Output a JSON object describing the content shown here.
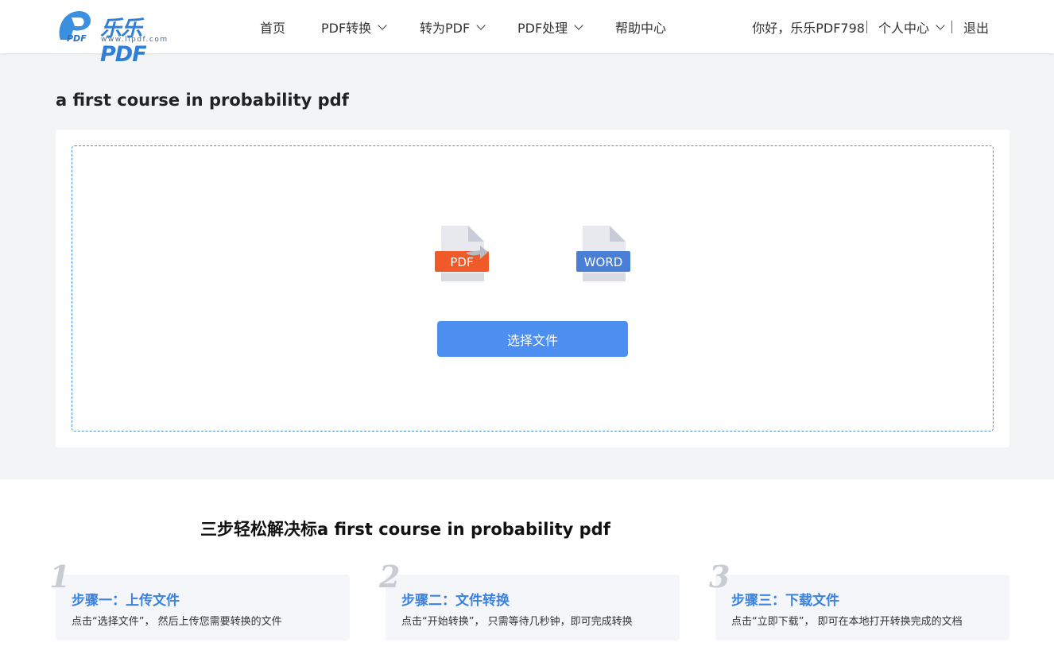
{
  "header": {
    "logo_text": "乐乐PDF",
    "logo_sub": "www.llpdf.com",
    "nav": [
      {
        "label": "首页",
        "has_dropdown": false
      },
      {
        "label": "PDF转换",
        "has_dropdown": true
      },
      {
        "label": "转为PDF",
        "has_dropdown": true
      },
      {
        "label": "PDF处理",
        "has_dropdown": true
      },
      {
        "label": "帮助中心",
        "has_dropdown": false
      }
    ],
    "greeting": "你好，乐乐PDF798",
    "user_center": "个人中心",
    "logout": "退出"
  },
  "main": {
    "title": "a first course in probability pdf",
    "from_format": "PDF",
    "to_format": "WORD",
    "select_button": "选择文件"
  },
  "steps": {
    "title": "三步轻松解决标a first course in probability pdf",
    "items": [
      {
        "num": "1",
        "title": "步骤一：上传文件",
        "desc": "点击“选择文件”， 然后上传您需要转换的文件"
      },
      {
        "num": "2",
        "title": "步骤二：文件转换",
        "desc": "点击“开始转换”， 只需等待几秒钟，即可完成转换"
      },
      {
        "num": "3",
        "title": "步骤三：下载文件",
        "desc": "点击“立即下载”， 即可在本地打开转换完成的文档"
      }
    ]
  },
  "colors": {
    "accent": "#4d8ff0",
    "pdf_red": "#f05a28",
    "word_blue": "#4a7fd8",
    "step_title": "#3b82e0"
  }
}
